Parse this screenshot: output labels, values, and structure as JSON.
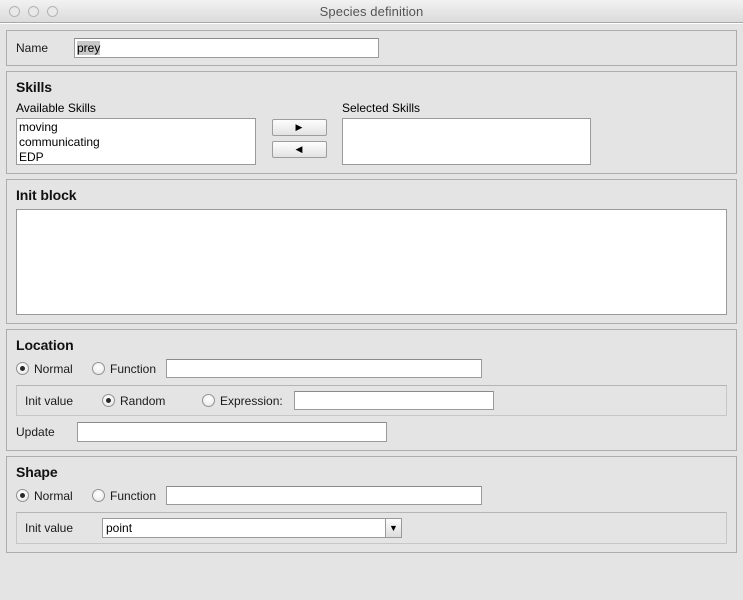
{
  "window": {
    "title": "Species definition",
    "traffic_lights": [
      "close-button",
      "minimize-button",
      "zoom-button"
    ]
  },
  "name_panel": {
    "label": "Name",
    "value": "prey",
    "placeholder": ""
  },
  "skills": {
    "title": "Skills",
    "available_label": "Available Skills",
    "selected_label": "Selected Skills",
    "available": [
      "moving",
      "communicating",
      "EDP"
    ],
    "selected": [],
    "add_button": "▶",
    "remove_button": "◀"
  },
  "init_block": {
    "title": "Init block",
    "value": "",
    "placeholder": ""
  },
  "location": {
    "title": "Location",
    "normal_label": "Normal",
    "normal_selected": true,
    "function_label": "Function",
    "function_selected": false,
    "function_value": "",
    "init_value_label": "Init value",
    "random_label": "Random",
    "random_selected": true,
    "expression_label": "Expression:",
    "expression_selected": false,
    "expression_value": "",
    "update_label": "Update",
    "update_value": ""
  },
  "shape": {
    "title": "Shape",
    "normal_label": "Normal",
    "normal_selected": true,
    "function_label": "Function",
    "function_selected": false,
    "function_value": "",
    "init_value_label": "Init value",
    "init_value_selected": "point",
    "dropdown_arrow": "▼"
  },
  "colors": {
    "window_bg": "#e4e4e4",
    "panel_border": "#adadad",
    "field_bg": "#ffffff",
    "field_border": "#9a9a9a",
    "title_text": "#555555",
    "text": "#1a1a1a",
    "selection": "#c8c8c8"
  }
}
